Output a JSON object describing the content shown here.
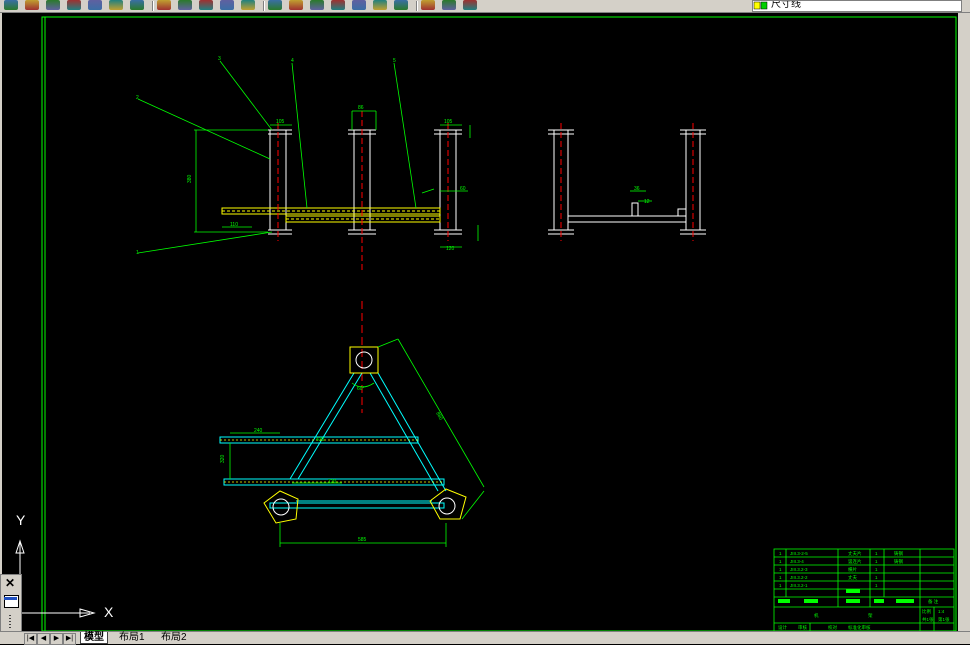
{
  "toolbar": {
    "layer_name": "尺寸线",
    "icons": [
      "new-icon",
      "open-icon",
      "save-icon",
      "print-icon",
      "preview-icon",
      "publish-icon",
      "plot-icon",
      "cut-icon",
      "copy-icon",
      "paste-icon",
      "matchprop-icon",
      "redo-icon",
      "pan-icon",
      "zoom-realtime-icon",
      "zoom-window-icon",
      "zoom-previous-icon",
      "properties-icon",
      "designcenter-icon",
      "toolpalette-icon",
      "calc-icon",
      "help-icon",
      "layer-manager-icon"
    ],
    "colors": {
      "face": "#d4d0c8",
      "model_bg": "#000000"
    }
  },
  "ucs": {
    "x_label": "X",
    "y_label": "Y"
  },
  "tabs": {
    "model": "模型",
    "layout1": "布局1",
    "layout2": "布局2"
  },
  "drawing": {
    "colors": {
      "frame": "#00ff00",
      "dimension": "#00ff00",
      "part": "#ffffff",
      "yellow": "#ffff00",
      "center": "#ff0000",
      "tube": "#00ffff",
      "title_block": "#00ff00"
    },
    "labels": {
      "b1": "1",
      "b2": "2",
      "b3": "3",
      "b4": "4",
      "b5": "5",
      "d_top1": "105",
      "d_top2": "86",
      "d_top3": "105",
      "d_height": "380",
      "d_left": "110",
      "d_mid": "60",
      "d_right1": "240",
      "d_right2": "120",
      "d_small": "36",
      "d_plate": "12",
      "d_angle": "60°",
      "d_diag": "880",
      "d_bar": "240",
      "d_bar2": "320",
      "d_bot": "720",
      "d_base": "585",
      "d_side": "420"
    },
    "title_block": {
      "rows": [
        {
          "no": "1",
          "code": "JIII.3-2-5",
          "name": "丈夫片",
          "qty": "1",
          "mat": "铸钢"
        },
        {
          "no": "1",
          "code": "JIII.3-4",
          "name": "竖连片",
          "qty": "1",
          "mat": "铸钢"
        },
        {
          "no": "1",
          "code": "JIII.3.2-3",
          "name": "横片",
          "qty": "1",
          "mat": ""
        },
        {
          "no": "1",
          "code": "JIII.3.2-2",
          "name": "丈夫",
          "qty": "1",
          "mat": ""
        },
        {
          "no": "1",
          "code": "JIII.3.2-1",
          "name": "",
          "qty": "1",
          "mat": ""
        }
      ],
      "header_remark": "备 注",
      "title_big": "机",
      "title_big2": "架",
      "ratio_label": "比例",
      "ratio": "1:4",
      "sheet": "共1张",
      "sheet2": "第1张",
      "footer1": "设计",
      "footer2": "审核",
      "footer3": "校对",
      "footer4": "标准化审核"
    }
  }
}
